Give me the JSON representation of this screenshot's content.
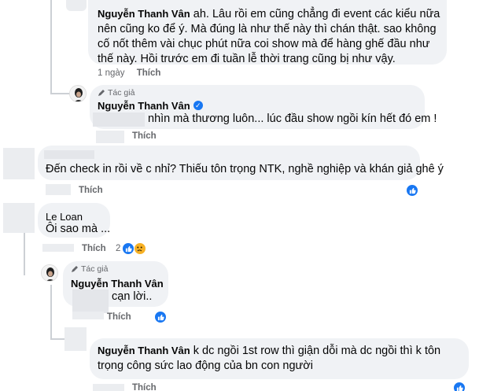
{
  "comments": [
    {
      "name": "Nguyễn Thanh Vân",
      "text": "ah. Lâu rồi em cũng chẳng đi event các kiểu nữa nên cũng ko để ý. Mà đúng là như thế này thì chán thật. sao không cố nốt thêm vài chục phút nữa coi show mà để hàng ghế đầu như thế này. Hồi trước em đi tuần lễ thời trang cũng bị như vậy.",
      "time": "1 ngày",
      "like": "Thích"
    },
    {
      "author_tag": "Tác giả",
      "name": "Nguyễn Thanh Vân",
      "text": "nhìn mà thương luôn... lúc đầu show ngồi kín hết đó em !",
      "like": "Thích"
    },
    {
      "text": "Đến check in rồi về c nhỉ? Thiếu tôn trọng NTK, nghề nghiệp và khán giả ghê ý",
      "like": "Thích"
    },
    {
      "name": "Le Loan",
      "text": "Ôi sao mà ...",
      "like": "Thích",
      "reaction_count": "2"
    },
    {
      "author_tag": "Tác giả",
      "name": "Nguyễn Thanh Vân",
      "text": "cạn lời..",
      "like": "Thích"
    },
    {
      "name": "Nguyễn Thanh Vân",
      "text": "k dc ngồi 1st row thì giận dỗi mà dc ngồi thì k tôn trọng công sức lao động của bn con người",
      "like": "Thích"
    }
  ],
  "icons": {
    "verified": "verified-badge-icon",
    "author": "pen-icon",
    "like_reaction": "like-reaction-icon",
    "sad_reaction": "sad-reaction-icon"
  },
  "colors": {
    "bubble": "#f0f2f5",
    "meta": "#65676b",
    "facebook_blue": "#1877f2"
  }
}
